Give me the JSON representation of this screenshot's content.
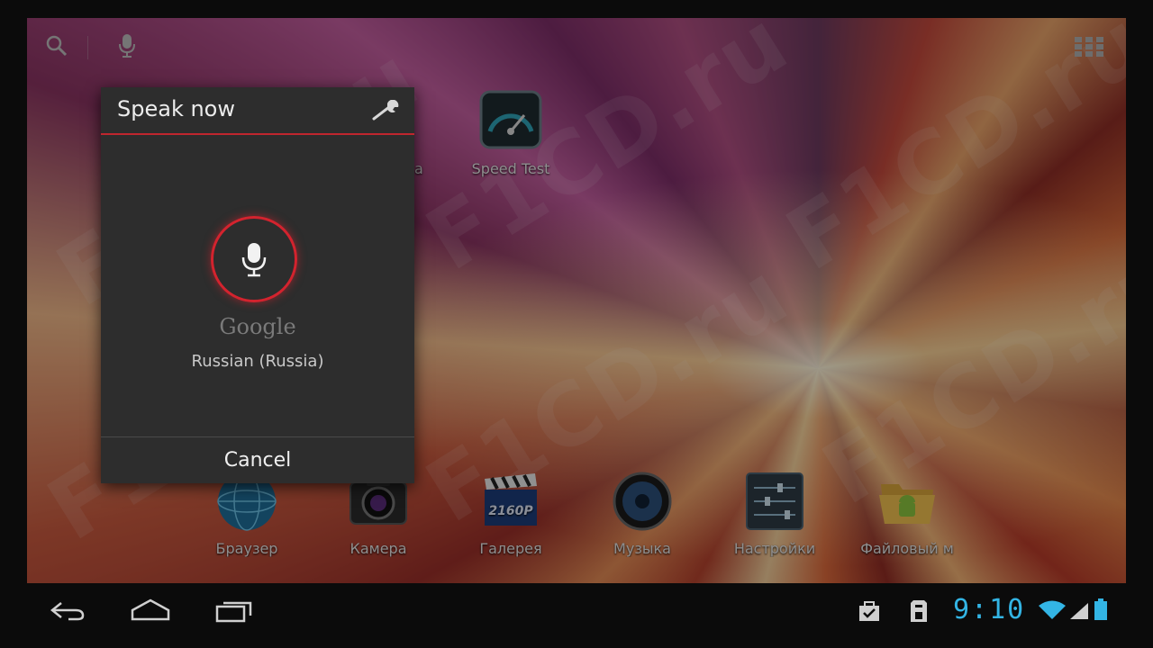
{
  "dialog": {
    "title": "Speak now",
    "engine": "Google",
    "language": "Russian (Russia)",
    "cancel_label": "Cancel"
  },
  "apps_top": [
    {
      "label": "Speed Test",
      "icon": "speedometer-icon"
    }
  ],
  "dock": [
    {
      "label": "Браузер",
      "icon": "globe-icon"
    },
    {
      "label": "Камера",
      "icon": "camera-icon"
    },
    {
      "label": "Галерея",
      "icon": "clapperboard-icon"
    },
    {
      "label": "Музыка",
      "icon": "speaker-icon"
    },
    {
      "label": "Настройки",
      "icon": "sliders-icon"
    },
    {
      "label": "Файловый м",
      "icon": "folder-android-icon"
    }
  ],
  "partial_label": "a",
  "statusbar": {
    "clock": "9:10"
  },
  "watermark": "F1CD.ru",
  "colors": {
    "accent_red": "#d3232e",
    "holo_blue": "#33b5e5",
    "dialog_bg": "#2d2d2d"
  }
}
